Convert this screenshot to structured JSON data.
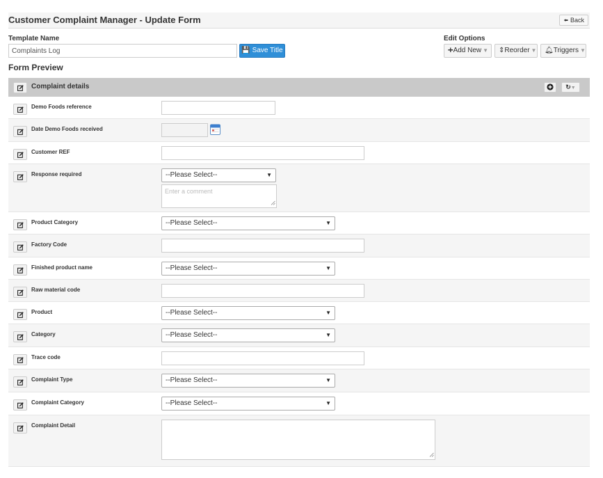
{
  "header": {
    "title": "Customer Complaint Manager - Update Form",
    "back_label": "Back"
  },
  "template": {
    "label": "Template Name",
    "value": "Complaints Log",
    "save_label": "Save Title"
  },
  "edit_options": {
    "label": "Edit Options",
    "add_new": "Add New",
    "reorder": "Reorder",
    "triggers": "Triggers"
  },
  "preview": {
    "heading": "Form Preview",
    "section_title": "Complaint details",
    "fields": [
      {
        "label": "Demo Foods reference",
        "type": "text"
      },
      {
        "label": "Date Demo Foods received",
        "type": "date"
      },
      {
        "label": "Customer REF",
        "type": "text"
      },
      {
        "label": "Response required",
        "type": "select-comment",
        "value": "--Please Select--",
        "comment_placeholder": "Enter a comment"
      },
      {
        "label": "Product Category",
        "type": "select",
        "value": "--Please Select--"
      },
      {
        "label": "Factory Code",
        "type": "text"
      },
      {
        "label": "Finished product name",
        "type": "select",
        "value": "--Please Select--"
      },
      {
        "label": "Raw material code",
        "type": "text"
      },
      {
        "label": "Product",
        "type": "select",
        "value": "--Please Select--"
      },
      {
        "label": "Category",
        "type": "select",
        "value": "--Please Select--"
      },
      {
        "label": "Trace code",
        "type": "text"
      },
      {
        "label": "Complaint Type",
        "type": "select",
        "value": "--Please Select--"
      },
      {
        "label": "Complaint Category",
        "type": "select",
        "value": "--Please Select--"
      },
      {
        "label": "Complaint Detail",
        "type": "textarea"
      }
    ]
  },
  "colors": {
    "accent": "#2f8fd8",
    "section_bg": "#c9c9c9",
    "alt_row": "#f5f5f5"
  }
}
